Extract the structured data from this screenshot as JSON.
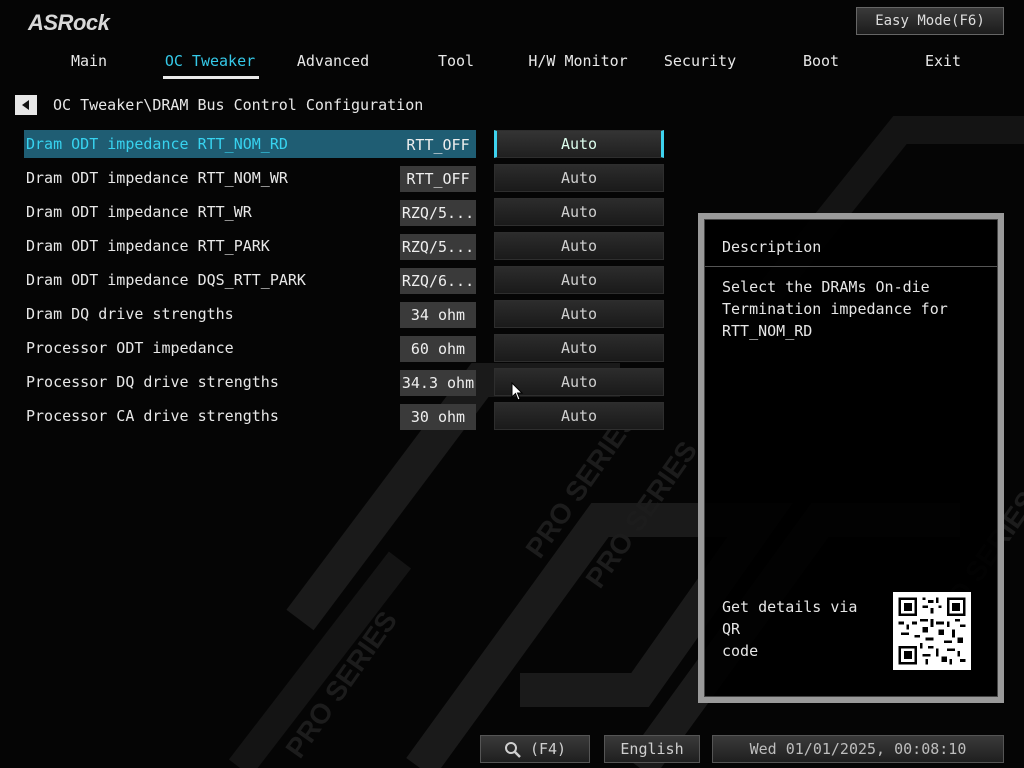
{
  "brand": {
    "logo": "ASRock"
  },
  "header": {
    "easy_mode_label": "Easy Mode(F6)"
  },
  "tabs": [
    {
      "label": "Main"
    },
    {
      "label": "OC Tweaker",
      "active": true
    },
    {
      "label": "Advanced"
    },
    {
      "label": "Tool"
    },
    {
      "label": "H/W Monitor"
    },
    {
      "label": "Security"
    },
    {
      "label": "Boot"
    },
    {
      "label": "Exit"
    }
  ],
  "breadcrumb": {
    "path": "OC Tweaker\\DRAM Bus Control Configuration"
  },
  "settings": [
    {
      "label": "Dram ODT impedance RTT_NOM_RD",
      "value": "RTT_OFF",
      "option": "Auto",
      "selected": true
    },
    {
      "label": "Dram ODT impedance RTT_NOM_WR",
      "value": "RTT_OFF",
      "option": "Auto"
    },
    {
      "label": "Dram ODT impedance RTT_WR",
      "value": "RZQ/5...",
      "option": "Auto"
    },
    {
      "label": "Dram ODT impedance RTT_PARK",
      "value": "RZQ/5...",
      "option": "Auto"
    },
    {
      "label": "Dram ODT impedance DQS_RTT_PARK",
      "value": "RZQ/6...",
      "option": "Auto"
    },
    {
      "label": "Dram DQ drive strengths",
      "value": "34 ohm",
      "option": "Auto"
    },
    {
      "label": "Processor ODT impedance",
      "value": "60 ohm",
      "option": "Auto"
    },
    {
      "label": "Processor DQ drive strengths",
      "value": "34.3 ohm",
      "option": "Auto"
    },
    {
      "label": "Processor CA drive strengths",
      "value": "30 ohm",
      "option": "Auto"
    }
  ],
  "description": {
    "title": "Description",
    "body": "Select the DRAMs On-die\nTermination impedance for\nRTT_NOM_RD",
    "qr_text": "Get details via QR\ncode"
  },
  "footer": {
    "search_label": "(F4)",
    "language": "English",
    "datetime": "Wed 01/01/2025, 00:08:10"
  },
  "colors": {
    "accent": "#35c9e8",
    "selected_row": "#1f5d73",
    "panel_border": "#9a9a9a"
  }
}
